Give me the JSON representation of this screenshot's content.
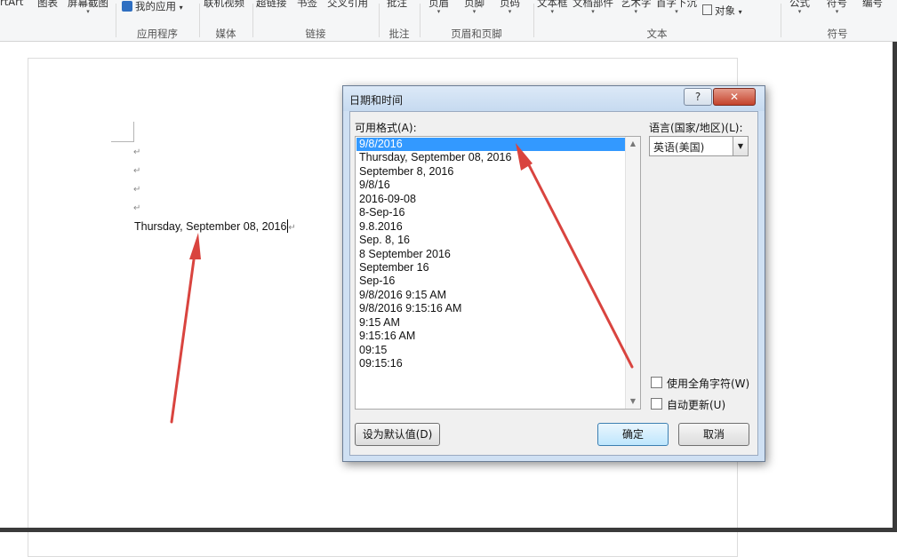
{
  "ribbon": {
    "groups": [
      {
        "label": "",
        "items": [
          "rtArt",
          "图表",
          "屏幕截图"
        ]
      },
      {
        "label": "应用程序",
        "items": [
          "我的应用"
        ]
      },
      {
        "label": "媒体",
        "items": [
          "联机视频"
        ]
      },
      {
        "label": "链接",
        "items": [
          "超链接",
          "书签",
          "交叉引用"
        ]
      },
      {
        "label": "批注",
        "items": [
          "批注"
        ]
      },
      {
        "label": "页眉和页脚",
        "items": [
          "页眉",
          "页脚",
          "页码"
        ]
      },
      {
        "label": "文本",
        "items": [
          "文本框",
          "文档部件",
          "艺术字",
          "首字下沉",
          "对象"
        ]
      },
      {
        "label": "符号",
        "items": [
          "公式",
          "符号",
          "编号"
        ]
      }
    ]
  },
  "document": {
    "inserted_text": "Thursday, September 08, 2016",
    "para_mark": "↵"
  },
  "dialog": {
    "title": "日期和时间",
    "help_label": "?",
    "close_label": "✕",
    "formats_label": "可用格式(A):",
    "formats": [
      "9/8/2016",
      "Thursday, September 08, 2016",
      "September 8, 2016",
      "9/8/16",
      "2016-09-08",
      "8-Sep-16",
      "9.8.2016",
      "Sep. 8, 16",
      "8 September 2016",
      "September 16",
      "Sep-16",
      "9/8/2016 9:15 AM",
      "9/8/2016 9:15:16 AM",
      "9:15 AM",
      "9:15:16 AM",
      "09:15",
      "09:15:16"
    ],
    "selected_index": 0,
    "language_label": "语言(国家/地区)(L):",
    "language_value": "英语(美国)",
    "fullwidth_label": "使用全角字符(W)",
    "autoupdate_label": "自动更新(U)",
    "set_default_label": "设为默认值(D)",
    "ok_label": "确定",
    "cancel_label": "取消"
  },
  "colors": {
    "selection": "#3399ff",
    "annotation_arrow": "#d9443f",
    "dialog_frame": "#cfe0f3"
  }
}
